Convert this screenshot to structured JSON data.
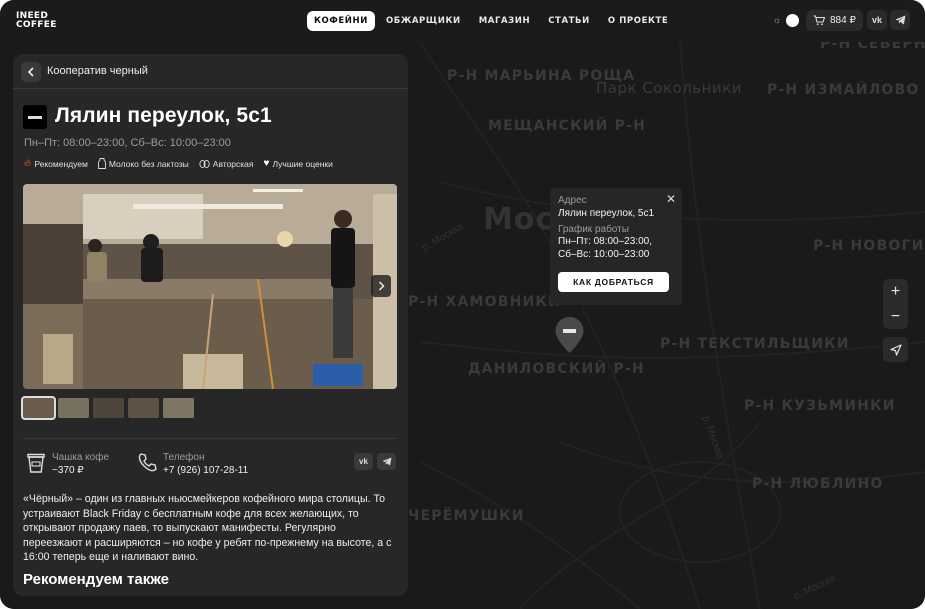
{
  "header": {
    "logo_line1": "INEED",
    "logo_line2": "COFFEE",
    "nav": [
      {
        "label": "КОФЕЙНИ",
        "active": true
      },
      {
        "label": "ОБЖАРЩИКИ",
        "active": false
      },
      {
        "label": "МАГАЗИН",
        "active": false
      },
      {
        "label": "СТАТЬИ",
        "active": false
      },
      {
        "label": "О ПРОЕКТЕ",
        "active": false
      }
    ],
    "cart_total": "884 ₽",
    "social": [
      "VK",
      "Telegram"
    ]
  },
  "map": {
    "districts": [
      "Р-Н МАРЬИНА РОЩА",
      "Р-Н СЕВЕРНОЕ ИЗМАЙЛОВО",
      "Р-Н ИЗМАЙЛОВО",
      "МЕЩАНСКИЙ Р-Н",
      "Парк Сокольники",
      "Р-Н НОВОГИРЕЕВО",
      "Р-Н ХАМОВНИКИ",
      "Р-Н ТЕКСТИЛЬЩИКИ",
      "ДАНИЛОВСКИЙ Р-Н",
      "Р-Н КУЗЬМИНКИ",
      "Р-Н ЛЮБЛИНО",
      "ЧЕРЁМУШКИ",
      "Москва"
    ],
    "streets": [
      "р. Москва",
      "р. Москва",
      "р. Москва"
    ]
  },
  "panel": {
    "breadcrumb": "Кооператив черный",
    "title": "Лялин переулок, 5с1",
    "hours": "Пн–Пт: 08:00–23:00, Сб–Вс: 10:00–23:00",
    "tags": [
      {
        "icon": "flame-icon",
        "label": "Рекомендуем"
      },
      {
        "icon": "milk-icon",
        "label": "Молоко без лактозы"
      },
      {
        "icon": "beans-icon",
        "label": "Авторская"
      },
      {
        "icon": "heart-icon",
        "label": "Лучшие оценки"
      }
    ],
    "cup_label": "Чашка кофе",
    "cup_value": "~370 ₽",
    "phone_label": "Телефон",
    "phone_value": "+7 (926) 107-28-11",
    "description": "«Чёрный» – один из главных ньюсмейкеров кофейного мира столицы. То устраивают Black Friday с бесплатным кофе для всех желающих, то открывают продажу паев, то выпускают манифесты. Регулярно переезжают и расширяются – но кофе у ребят по-прежнему на высоте, а с 16:00 теперь еще и наливают вино.",
    "recommend_title": "Рекомендуем также"
  },
  "popup": {
    "address_label": "Адрес",
    "address_value": "Лялин переулок, 5с1",
    "schedule_label": "График работы",
    "schedule_line1": "Пн–Пт: 08:00–23:00,",
    "schedule_line2": "Сб–Вс: 10:00–23:00",
    "route_button": "КАК ДОБРАТЬСЯ"
  }
}
